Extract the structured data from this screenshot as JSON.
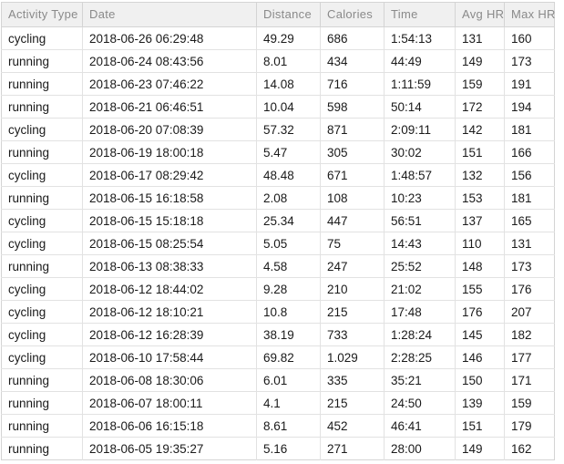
{
  "table": {
    "columns": [
      {
        "key": "activity_type",
        "label": "Activity Type"
      },
      {
        "key": "date",
        "label": "Date"
      },
      {
        "key": "distance",
        "label": "Distance"
      },
      {
        "key": "calories",
        "label": "Calories"
      },
      {
        "key": "time",
        "label": "Time"
      },
      {
        "key": "avg_hr",
        "label": "Avg HR"
      },
      {
        "key": "max_hr",
        "label": "Max HR"
      }
    ],
    "rows": [
      {
        "activity_type": "cycling",
        "date": "2018-06-26 06:29:48",
        "distance": "49.29",
        "calories": "686",
        "time": "1:54:13",
        "avg_hr": "131",
        "max_hr": "160"
      },
      {
        "activity_type": "running",
        "date": "2018-06-24 08:43:56",
        "distance": "8.01",
        "calories": "434",
        "time": "44:49",
        "avg_hr": "149",
        "max_hr": "173"
      },
      {
        "activity_type": "running",
        "date": "2018-06-23 07:46:22",
        "distance": "14.08",
        "calories": "716",
        "time": "1:11:59",
        "avg_hr": "159",
        "max_hr": "191"
      },
      {
        "activity_type": "running",
        "date": "2018-06-21 06:46:51",
        "distance": "10.04",
        "calories": "598",
        "time": "50:14",
        "avg_hr": "172",
        "max_hr": "194"
      },
      {
        "activity_type": "cycling",
        "date": "2018-06-20 07:08:39",
        "distance": "57.32",
        "calories": "871",
        "time": "2:09:11",
        "avg_hr": "142",
        "max_hr": "181"
      },
      {
        "activity_type": "running",
        "date": "2018-06-19 18:00:18",
        "distance": "5.47",
        "calories": "305",
        "time": "30:02",
        "avg_hr": "151",
        "max_hr": "166"
      },
      {
        "activity_type": "cycling",
        "date": "2018-06-17 08:29:42",
        "distance": "48.48",
        "calories": "671",
        "time": "1:48:57",
        "avg_hr": "132",
        "max_hr": "156"
      },
      {
        "activity_type": "running",
        "date": "2018-06-15 16:18:58",
        "distance": "2.08",
        "calories": "108",
        "time": "10:23",
        "avg_hr": "153",
        "max_hr": "181"
      },
      {
        "activity_type": "cycling",
        "date": "2018-06-15 15:18:18",
        "distance": "25.34",
        "calories": "447",
        "time": "56:51",
        "avg_hr": "137",
        "max_hr": "165"
      },
      {
        "activity_type": "cycling",
        "date": "2018-06-15 08:25:54",
        "distance": "5.05",
        "calories": "75",
        "time": "14:43",
        "avg_hr": "110",
        "max_hr": "131"
      },
      {
        "activity_type": "running",
        "date": "2018-06-13 08:38:33",
        "distance": "4.58",
        "calories": "247",
        "time": "25:52",
        "avg_hr": "148",
        "max_hr": "173"
      },
      {
        "activity_type": "cycling",
        "date": "2018-06-12 18:44:02",
        "distance": "9.28",
        "calories": "210",
        "time": "21:02",
        "avg_hr": "155",
        "max_hr": "176"
      },
      {
        "activity_type": "cycling",
        "date": "2018-06-12 18:10:21",
        "distance": "10.8",
        "calories": "215",
        "time": "17:48",
        "avg_hr": "176",
        "max_hr": "207"
      },
      {
        "activity_type": "cycling",
        "date": "2018-06-12 16:28:39",
        "distance": "38.19",
        "calories": "733",
        "time": "1:28:24",
        "avg_hr": "145",
        "max_hr": "182"
      },
      {
        "activity_type": "cycling",
        "date": "2018-06-10 17:58:44",
        "distance": "69.82",
        "calories": "1.029",
        "time": "2:28:25",
        "avg_hr": "146",
        "max_hr": "177"
      },
      {
        "activity_type": "running",
        "date": "2018-06-08 18:30:06",
        "distance": "6.01",
        "calories": "335",
        "time": "35:21",
        "avg_hr": "150",
        "max_hr": "171"
      },
      {
        "activity_type": "running",
        "date": "2018-06-07 18:00:11",
        "distance": "4.1",
        "calories": "215",
        "time": "24:50",
        "avg_hr": "139",
        "max_hr": "159"
      },
      {
        "activity_type": "running",
        "date": "2018-06-06 16:15:18",
        "distance": "8.61",
        "calories": "452",
        "time": "46:41",
        "avg_hr": "151",
        "max_hr": "179"
      },
      {
        "activity_type": "running",
        "date": "2018-06-05 19:35:27",
        "distance": "5.16",
        "calories": "271",
        "time": "28:00",
        "avg_hr": "149",
        "max_hr": "162"
      }
    ]
  }
}
